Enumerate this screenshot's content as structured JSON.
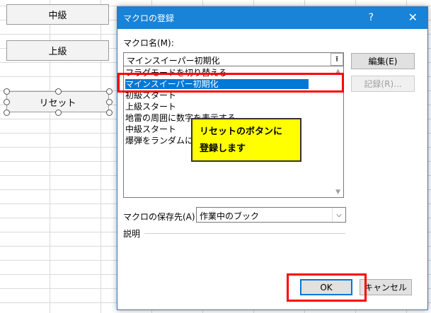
{
  "sheet": {
    "buttons": [
      {
        "label": "中級"
      },
      {
        "label": "上級"
      },
      {
        "label": "リセット"
      }
    ]
  },
  "dialog": {
    "title": "マクロの登録",
    "help": "?",
    "close": "✕",
    "macro_name_label": "マクロ名(M):",
    "macro_name_value": "マインスイーパー初期化",
    "up_arrow": "⭱",
    "list_items": [
      "フラグモードを切り替える",
      "マインスイーパー初期化",
      "初級スタート",
      "上級スタート",
      "地雷の周囲に数字を表示する",
      "中級スタート",
      "爆弾をランダムに配置"
    ],
    "selected_index": 1,
    "edit_button": "編集(E)",
    "record_button": "記録(R)...",
    "store_in_label": "マクロの保存先(A):",
    "store_in_value": "作業中のブック",
    "description_label": "説明",
    "ok_button": "OK",
    "cancel_button": "キャンセル"
  },
  "annotation": {
    "callout_line1": "リセットのボタンに",
    "callout_line2": "登録します",
    "highlight_color": "#ff0000",
    "callout_color": "#ffff00"
  }
}
